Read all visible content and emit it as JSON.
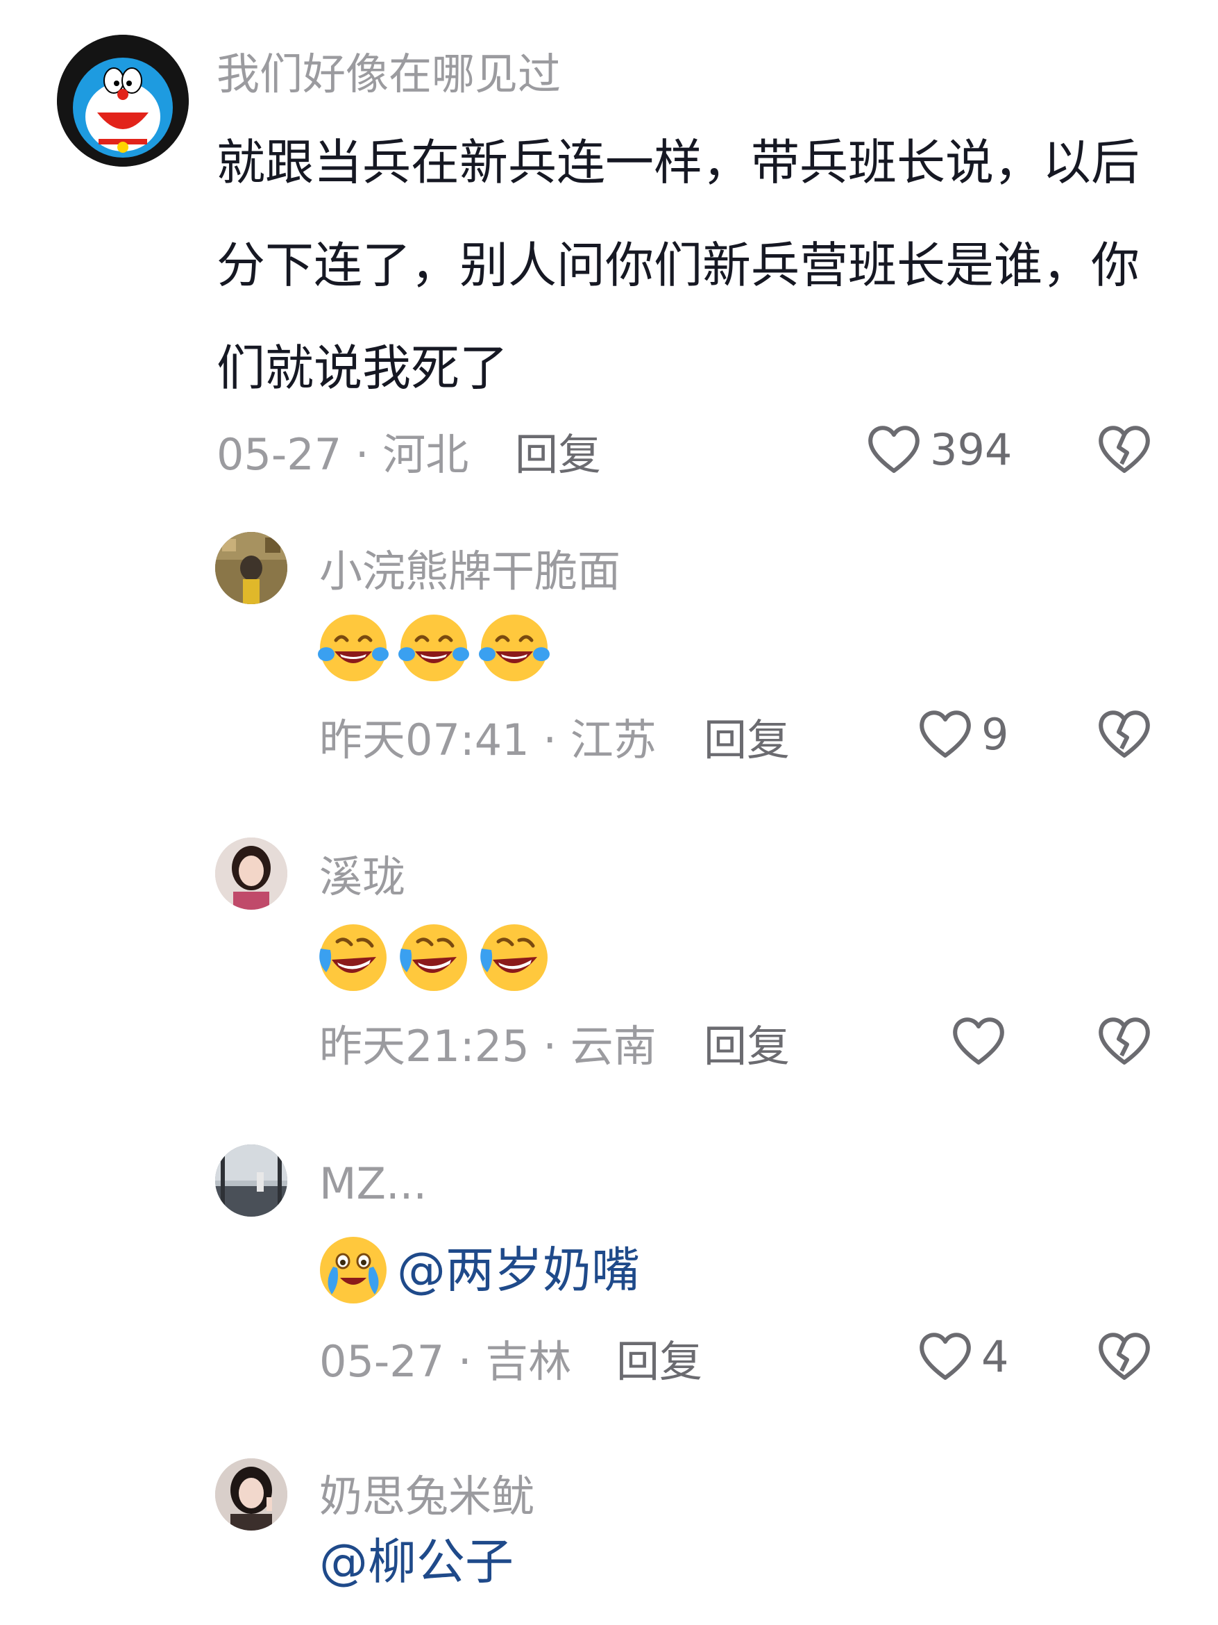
{
  "comments": [
    {
      "username": "我们好像在哪见过",
      "text": "就跟当兵在新兵连一样，带兵班长说，以后分下连了，别人问你们新兵营班长是谁，你们就说我死了",
      "meta": "05-27 · 河北",
      "reply": "回复",
      "likes": "394"
    },
    {
      "username": "小浣熊牌干脆面",
      "emoji": "tears-of-joy",
      "meta": "昨天07:41 · 江苏",
      "reply": "回复",
      "likes": "9"
    },
    {
      "username": "溪珑",
      "emoji": "rolling-on-floor-laughing",
      "meta": "昨天21:25 · 云南",
      "reply": "回复",
      "likes": ""
    },
    {
      "username": "MZ...",
      "emoji": "crying-laughing",
      "mention": "@两岁奶嘴",
      "meta": "05-27 · 吉林",
      "reply": "回复",
      "likes": "4"
    },
    {
      "username": "奶思兔米鱿",
      "mention": "@柳公子"
    }
  ],
  "colors": {
    "username": "#9b9b9f",
    "meta": "#9b9b9f",
    "reply": "#6b6b70",
    "mention": "#1f4a8a",
    "text": "#161823"
  }
}
